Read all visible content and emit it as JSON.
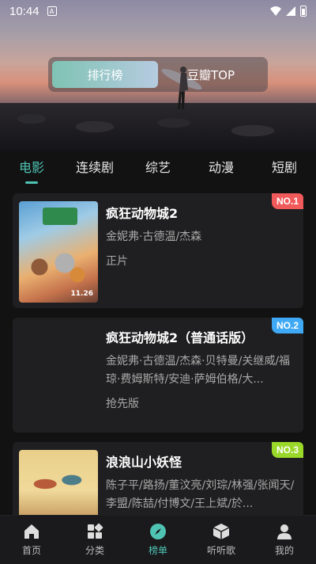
{
  "status_bar": {
    "time": "10:44",
    "a_icon": "A"
  },
  "header": {
    "toggle": [
      {
        "label": "排行榜",
        "active": true
      },
      {
        "label": "豆瓣TOP",
        "active": false
      }
    ]
  },
  "tabs": [
    {
      "label": "电影",
      "active": true
    },
    {
      "label": "连续剧",
      "active": false
    },
    {
      "label": "综艺",
      "active": false
    },
    {
      "label": "动漫",
      "active": false
    },
    {
      "label": "短剧",
      "active": false
    }
  ],
  "items": [
    {
      "title": "疯狂动物城2",
      "cast": "金妮弗·古德温/杰森",
      "tag": "正片",
      "rank": "NO.1",
      "rank_color": "#f05a5a",
      "poster_text": "11.26"
    },
    {
      "title": "疯狂动物城2（普通话版）",
      "cast": "金妮弗·古德温/杰森·贝特曼/关继威/福琼·费姆斯特/安迪·萨姆伯格/大...",
      "tag": "抢先版",
      "rank": "NO.2",
      "rank_color": "#3fa9f5"
    },
    {
      "title": "浪浪山小妖怪",
      "cast": "陈子平/路扬/董汶亮/刘琮/林强/张闻天/李盟/陈喆/付博文/王上斌/於...",
      "tag": "",
      "rank": "NO.3",
      "rank_color": "#9ad82a"
    }
  ],
  "bottom_nav": [
    {
      "label": "首页",
      "icon": "home-icon",
      "active": false
    },
    {
      "label": "分类",
      "icon": "grid-icon",
      "active": false
    },
    {
      "label": "榜单",
      "icon": "compass-icon",
      "active": true
    },
    {
      "label": "听听歌",
      "icon": "box-icon",
      "active": false
    },
    {
      "label": "我的",
      "icon": "user-icon",
      "active": false
    }
  ]
}
